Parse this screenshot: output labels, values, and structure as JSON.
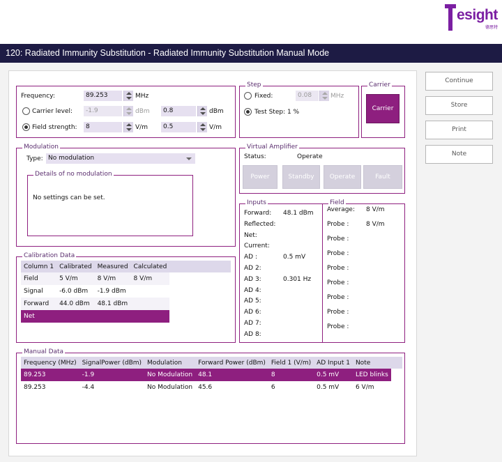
{
  "logo": {
    "text": "esight",
    "sub": "德思特"
  },
  "window_title": "120: Radiated Immunity Substitution - Radiated Immunity Substitution Manual Mode",
  "colors": {
    "accent": "#8e1f7f",
    "titlebar": "#1d1b44"
  },
  "freq": {
    "frequency_label": "Frequency:",
    "frequency_value": "89.253",
    "frequency_unit": "MHz",
    "carrier_label": "Carrier level:",
    "carrier_value": "-1.9",
    "carrier_unit": "dBm",
    "carrier_value2": "0.8",
    "carrier_unit2": "dBm",
    "field_label": "Field strength:",
    "field_value": "8",
    "field_unit": "V/m",
    "field_value2": "0.5",
    "field_unit2": "V/m"
  },
  "step": {
    "title": "Step",
    "fixed_label": "Fixed:",
    "fixed_value": "0.08",
    "fixed_unit": "MHz",
    "test_step_label": "Test Step: 1 %"
  },
  "carrier": {
    "title": "Carrier",
    "button": "Carrier"
  },
  "side_buttons": {
    "continue": "Continue",
    "store": "Store",
    "print": "Print",
    "note": "Note"
  },
  "modulation": {
    "title": "Modulation",
    "type_label": "Type:",
    "type_value": "No modulation",
    "details_title": "Details of no modulation",
    "details_text": "No settings can be set."
  },
  "amplifier": {
    "title": "Virtual Amplifier",
    "status_label": "Status:",
    "status_value": "Operate",
    "power": "Power",
    "standby": "Standby",
    "operate": "Operate",
    "fault": "Fault"
  },
  "calibration": {
    "title": "Calibration Data",
    "headers": [
      "Column 1",
      "Calibrated",
      "Measured",
      "Calculated"
    ],
    "rows": [
      [
        "Field",
        "5 V/m",
        "8 V/m",
        "8 V/m"
      ],
      [
        "Signal",
        "-6.0 dBm",
        "-1.9 dBm",
        ""
      ],
      [
        "Forward",
        "44.0 dBm",
        "48.1 dBm",
        ""
      ],
      [
        "Net",
        "",
        "",
        ""
      ]
    ]
  },
  "inputs": {
    "title": "Inputs",
    "rows": [
      [
        "Forward:",
        "48.1 dBm"
      ],
      [
        "Reflected:",
        ""
      ],
      [
        "Net:",
        ""
      ],
      [
        "Current:",
        ""
      ],
      [
        "AD :",
        "0.5 mV"
      ],
      [
        "AD 2:",
        ""
      ],
      [
        "AD 3:",
        "0.301 Hz"
      ],
      [
        "AD 4:",
        ""
      ],
      [
        "AD 5:",
        ""
      ],
      [
        "AD 6:",
        ""
      ],
      [
        "AD 7:",
        ""
      ],
      [
        "AD 8:",
        ""
      ]
    ]
  },
  "field": {
    "title": "Field",
    "rows": [
      [
        "Average:",
        "8 V/m"
      ],
      [
        "Probe :",
        "8 V/m"
      ],
      [
        "Probe :",
        ""
      ],
      [
        "Probe :",
        ""
      ],
      [
        "Probe :",
        ""
      ],
      [
        "Probe :",
        ""
      ],
      [
        "Probe :",
        ""
      ],
      [
        "Probe :",
        ""
      ],
      [
        "Probe :",
        ""
      ]
    ]
  },
  "manual": {
    "title": "Manual Data",
    "headers": [
      "Frequency (MHz)",
      "SignalPower (dBm)",
      "Modulation",
      "Forward Power (dBm)",
      "Field 1 (V/m)",
      "AD Input 1",
      "Note"
    ],
    "rows": [
      [
        "89.253",
        "-1.9",
        "No Modulation",
        "48.1",
        "8",
        "0.5 mV",
        "LED blinks"
      ],
      [
        "89.253",
        "-4.4",
        "No Modulation",
        "45.6",
        "6",
        "0.5 mV",
        "6 V/m"
      ]
    ]
  }
}
